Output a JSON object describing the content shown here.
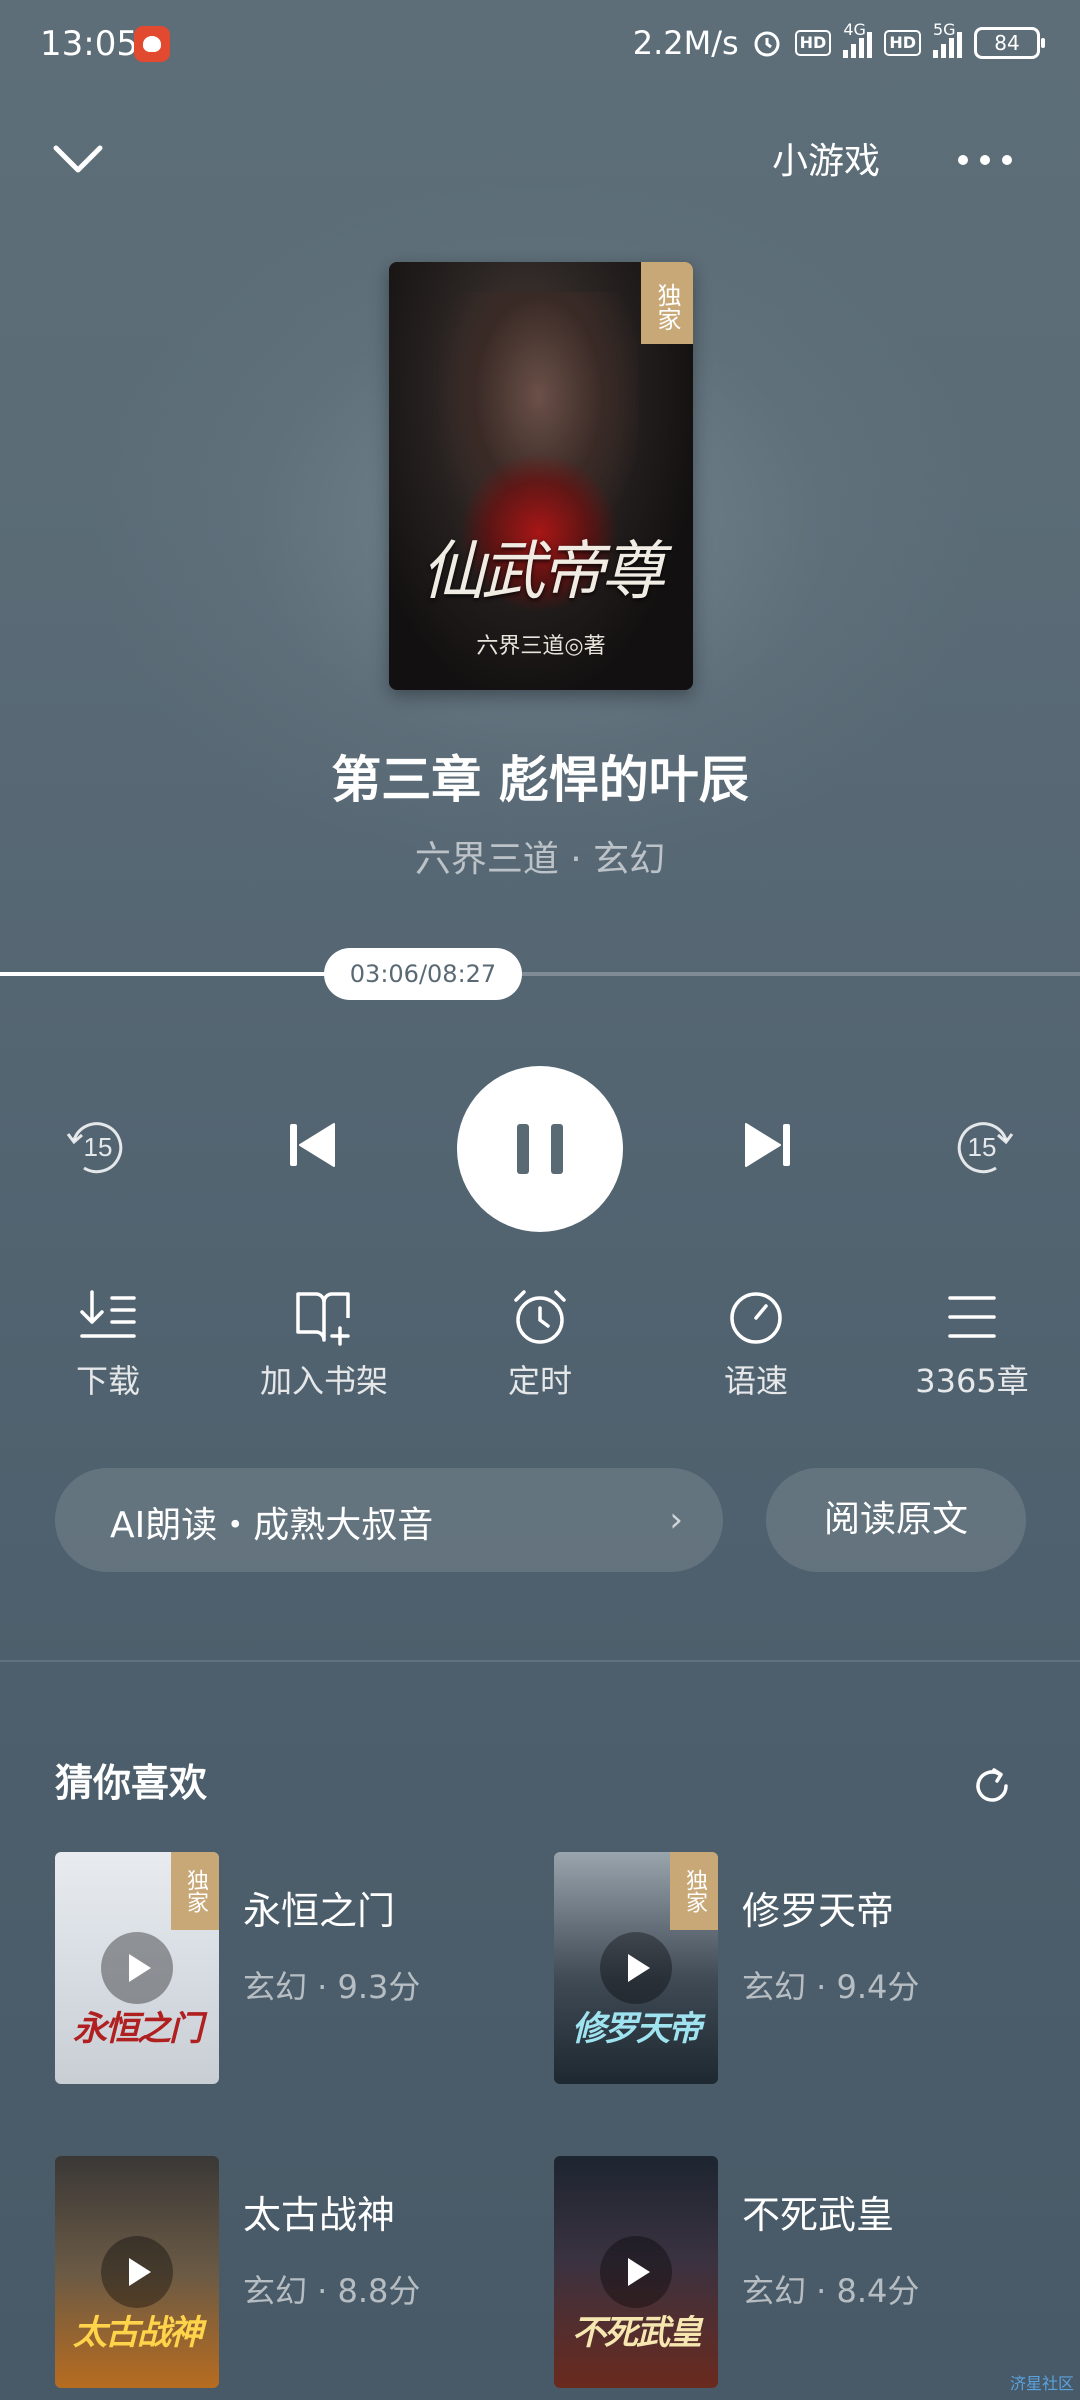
{
  "status_bar": {
    "time": "13:05",
    "network_speed": "2.2M/s",
    "hd1": "HD",
    "net1": "4G",
    "hd2": "HD",
    "net2": "5G",
    "battery": "84"
  },
  "header": {
    "mini_game": "小游戏"
  },
  "cover": {
    "exclusive_tag": "独家",
    "title_art": "仙武帝尊",
    "author_art": "六界三道◎著"
  },
  "player": {
    "chapter_title": "第三章 彪悍的叶辰",
    "meta": "六界三道 · 玄幻",
    "time_display": "03:06/08:27",
    "progress_fraction": 0.367,
    "skip_seconds": "15"
  },
  "actions": [
    {
      "label": "下载",
      "icon": "download-icon"
    },
    {
      "label": "加入书架",
      "icon": "add-bookshelf-icon"
    },
    {
      "label": "定时",
      "icon": "alarm-clock-icon"
    },
    {
      "label": "语速",
      "icon": "speed-gauge-icon"
    },
    {
      "label": "3365章",
      "icon": "list-icon"
    }
  ],
  "ai_voice": {
    "label": "AI朗读・成熟大叔音",
    "arrow": "›"
  },
  "read_original": "阅读原文",
  "recommend": {
    "title": "猜你喜欢",
    "books": [
      {
        "name": "永恒之门",
        "info": "玄幻 · 9.3分",
        "tag": "独家",
        "caption": "永恒之门"
      },
      {
        "name": "修罗天帝",
        "info": "玄幻 · 9.4分",
        "tag": "独家",
        "caption": "修罗天帝"
      },
      {
        "name": "太古战神",
        "info": "玄幻 · 8.8分",
        "tag": "",
        "caption": "太古战神"
      },
      {
        "name": "不死武皇",
        "info": "玄幻 · 8.4分",
        "tag": "",
        "caption": "不死武皇"
      }
    ]
  },
  "watermark": "济星社区",
  "colors": {
    "background": "#546572",
    "exclusive_tag": "#c8a877",
    "accent_text": "#5a6a74"
  }
}
